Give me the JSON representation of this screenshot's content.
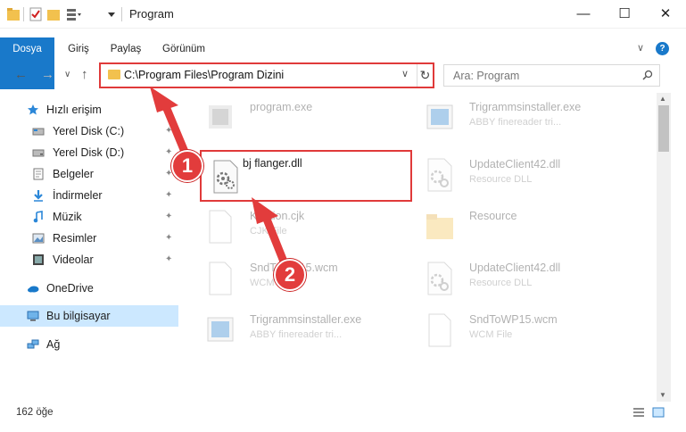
{
  "window": {
    "title": "Program",
    "minimize": "—",
    "maximize": "☐",
    "close": "✕"
  },
  "ribbon": {
    "tabs": [
      "Dosya",
      "Giriş",
      "Paylaş",
      "Görünüm"
    ],
    "expand": "∨",
    "help": "?"
  },
  "address": {
    "back": "←",
    "forward": "→",
    "history": "∨",
    "up": "↑",
    "path": "C:\\Program Files\\Program Dizini",
    "dropdown": "∨",
    "refresh": "↻"
  },
  "search": {
    "placeholder": "Ara: Program"
  },
  "sidebar": {
    "items": [
      {
        "label": "Hızlı erişim",
        "icon": "star-icon",
        "pinned": false
      },
      {
        "label": "Yerel Disk (C:)",
        "icon": "drive-icon",
        "pinned": true
      },
      {
        "label": "Yerel Disk (D:)",
        "icon": "drive-icon",
        "pinned": true
      },
      {
        "label": "Belgeler",
        "icon": "document-icon",
        "pinned": true
      },
      {
        "label": "İndirmeler",
        "icon": "download-icon",
        "pinned": true
      },
      {
        "label": "Müzik",
        "icon": "music-icon",
        "pinned": true
      },
      {
        "label": "Resimler",
        "icon": "picture-icon",
        "pinned": true
      },
      {
        "label": "Videolar",
        "icon": "video-icon",
        "pinned": true
      },
      {
        "label": "OneDrive",
        "icon": "cloud-icon",
        "pinned": false
      },
      {
        "label": "Bu bilgisayar",
        "icon": "computer-icon",
        "pinned": false
      },
      {
        "label": "Ağ",
        "icon": "network-icon",
        "pinned": false
      }
    ],
    "pin_glyph": "📌"
  },
  "files": [
    {
      "name": "program.exe",
      "desc": "",
      "icon": "exe-icon"
    },
    {
      "name": "Trigrammsinstaller.exe",
      "desc": "ABBY finereader tri...",
      "icon": "installer-icon"
    },
    {
      "name": "bj flanger.dll",
      "desc": "",
      "icon": "dll-gear-icon"
    },
    {
      "name": "UpdateClient42.dll",
      "desc": "Resource DLL",
      "icon": "dll-gear-icon"
    },
    {
      "name": "Kontion.cjk",
      "desc": "CJK File",
      "icon": "blank-file-icon"
    },
    {
      "name": "Resource",
      "desc": "",
      "icon": "folder-icon"
    },
    {
      "name": "SndToWP15.wcm",
      "desc": "WCM File",
      "icon": "blank-file-icon"
    },
    {
      "name": "UpdateClient42.dll",
      "desc": "Resource DLL",
      "icon": "dll-gear-icon"
    },
    {
      "name": "Trigrammsinstaller.exe",
      "desc": "ABBY finereader tri...",
      "icon": "installer-icon"
    },
    {
      "name": "SndToWP15.wcm",
      "desc": "WCM File",
      "icon": "blank-file-icon"
    }
  ],
  "status": {
    "count": "162 öğe"
  },
  "annotations": {
    "step1": "1",
    "step2": "2"
  },
  "colors": {
    "accent": "#1979ca",
    "highlight": "#e03a3a",
    "selection": "#cce8ff"
  }
}
